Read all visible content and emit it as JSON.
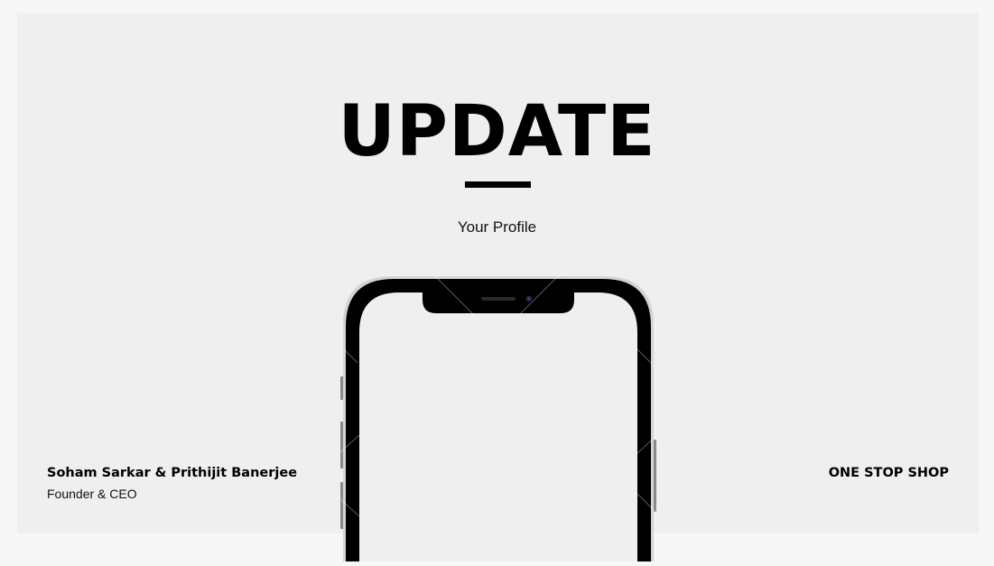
{
  "slide": {
    "title": "UPDATE",
    "subtitle": "Your Profile",
    "founders": "Soham Sarkar & Prithijit Banerjee",
    "role": "Founder & CEO",
    "brand": "ONE STOP SHOP"
  },
  "colors": {
    "background": "#efefef",
    "text": "#000000"
  },
  "icons": {
    "phone": "smartphone-mockup"
  }
}
